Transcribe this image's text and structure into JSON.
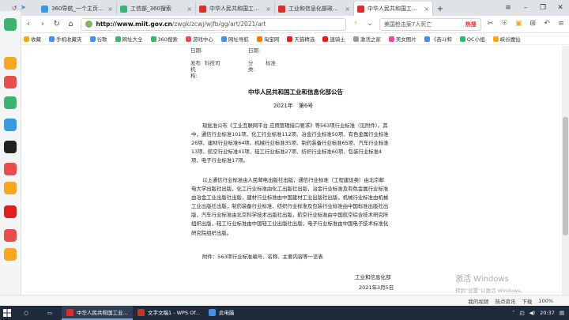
{
  "browser": {
    "tabs": [
      {
        "label": "360导航_一个主页，整",
        "color": "#3a9bdc",
        "active": false
      },
      {
        "label": "工信部_360搜索",
        "color": "#3cb371",
        "active": false
      },
      {
        "label": "中华人民共和国工业和",
        "color": "#d9302c",
        "active": false
      },
      {
        "label": "工业和信息化部政策文",
        "color": "#d9302c",
        "active": false
      },
      {
        "label": "中华人民共和国工业和",
        "color": "#d9302c",
        "active": true
      }
    ],
    "url_domain": "http://www.miit.gov.cn",
    "url_path": "/zwgk/zcwj/wjfb/gg/art/2021/art",
    "search_text": "美国枪击案7人死亡",
    "search_hot": "热搜"
  },
  "bookmarks": [
    {
      "label": "收藏",
      "color": "#f5a623"
    },
    {
      "label": "手机收藏夹",
      "color": "#4a90e2"
    },
    {
      "label": "谷歌",
      "color": "#4a90e2"
    },
    {
      "label": "网址大全",
      "color": "#3cb371"
    },
    {
      "label": "360搜索",
      "color": "#3cb371"
    },
    {
      "label": "游戏中心",
      "color": "#e94e4e"
    },
    {
      "label": "网址导航",
      "color": "#4a90e2"
    },
    {
      "label": "淘宝网",
      "color": "#ff7a00"
    },
    {
      "label": "天猫精选",
      "color": "#e02020"
    },
    {
      "label": "速骑士",
      "color": "#e02020"
    },
    {
      "label": "激活之家",
      "color": "#999999"
    },
    {
      "label": "美女图片",
      "color": "#e94e9a"
    },
    {
      "label": "《奋斗和",
      "color": "#4a90e2"
    },
    {
      "label": "QC小组",
      "color": "#3cb371"
    },
    {
      "label": "峡谷魔仙",
      "color": "#f5a623"
    }
  ],
  "doc": {
    "meta_date_label": "日期:",
    "meta_date_label2": "日期:",
    "meta_org_label": "发布机构:",
    "meta_org_value": "科技司",
    "meta_cat_label": "分类:",
    "meta_cat_value": "标准",
    "title": "中华人民共和国工业和信息化部公告",
    "number": "2021年　第6号",
    "para1": "现批准公布《工业互联网平台 应用管理接口要求》等563项行业标准（见附件）。其中，通信行业标准101项、化工行业标准112项、冶金行业标准50项、有色金属行业标准26项、建材行业标准64项、机械行业标准35项、制药装备行业标准65项、汽车行业标准13项、航空行业标准41项、轻工行业标准27项、纺织行业标准60项、包装行业标准4项、电子行业标准17项。",
    "para2": "以上通信行业标准由人民邮电出版社出版，通信行业标准（工程建设类）由北京邮电大学出版社出版，化工行业标准由化工出版社出版，冶金行业标准及有色金属行业标准由冶金工业出版社出版，建材行业标准由中国建材工业出版社出版，机械行业标准由机械工业出版社出版，制药装备行业标准、纺织行业标准及包装行业标准由中国标准出版社出版，汽车行业标准由北京科学技术出版社出版，航空行业标准由中国航空综合技术研究所组织出版，轻工行业标准由中国轻工业出版社出版，电子行业标准由中国电子技术标准化研究院组织出版。",
    "attachment": "附件：563项行业标准编号、名称、主要内容等一览表",
    "sign_org": "工业和信息化部",
    "sign_date": "2021年3月5日"
  },
  "statusbar": {
    "items": [
      "我的视频",
      "热点资讯",
      "下载",
      "100%"
    ]
  },
  "watermark": {
    "line1": "激活 Windows",
    "line2": "转到\"设置\"以激活 Windows。"
  },
  "taskbar": {
    "apps": [
      {
        "label": "中华人民共和国工业...",
        "color": "#d9302c",
        "active": true
      },
      {
        "label": "文字文稿1 - WPS Of...",
        "color": "#c0392b",
        "active": false
      },
      {
        "label": "此电脑",
        "color": "#4a90e2",
        "active": false
      }
    ],
    "time": "20:37"
  },
  "sidebar_icons": [
    {
      "name": "browser-e-icon",
      "color": "#3cb371"
    },
    {
      "name": "star-icon",
      "color": "#f5a623"
    },
    {
      "name": "weibo-icon",
      "color": "#e94e4e"
    },
    {
      "name": "mail-icon",
      "color": "#3cb371"
    },
    {
      "name": "p-app-icon",
      "color": "#3a9bdc"
    },
    {
      "name": "news-icon",
      "color": "#222222"
    },
    {
      "name": "game-icon",
      "color": "#e94e4e"
    },
    {
      "name": "face-icon",
      "color": "#f5a623"
    },
    {
      "name": "live-icon",
      "color": "#e02020"
    },
    {
      "name": "app-icon",
      "color": "#e94e4e"
    },
    {
      "name": "app2-icon",
      "color": "#f5a623"
    }
  ]
}
